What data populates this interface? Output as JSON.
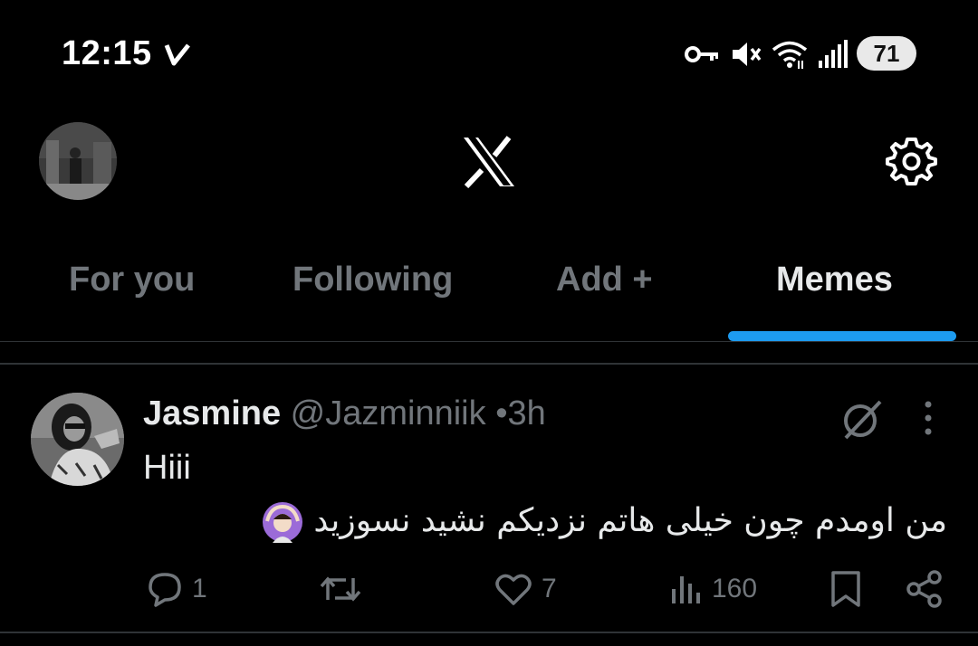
{
  "status_bar": {
    "time": "12:15",
    "battery": "71",
    "icons": [
      "key-icon",
      "muted-icon",
      "wifi-icon",
      "signal-icon"
    ]
  },
  "header": {
    "logo": "x-logo",
    "settings_icon": "gear-icon"
  },
  "tabs": [
    {
      "label": "For you",
      "active": false
    },
    {
      "label": "Following",
      "active": false
    },
    {
      "label": "Add +",
      "active": false
    },
    {
      "label": "Memes",
      "active": true
    }
  ],
  "post": {
    "name": "Jasmine",
    "handle": "@Jazminniik",
    "dot": "•",
    "time": "3h",
    "text_line1": "Hiii",
    "text_line2": "من اومدم چون خیلی هاتم نزدیکم نشید نسوزید",
    "actions": {
      "replies": "1",
      "reposts": "",
      "likes": "7",
      "views": "160"
    }
  },
  "colors": {
    "background": "#000000",
    "accent": "#1d9bf0",
    "muted_text": "#71767b",
    "primary_text": "#e7e9ea"
  }
}
